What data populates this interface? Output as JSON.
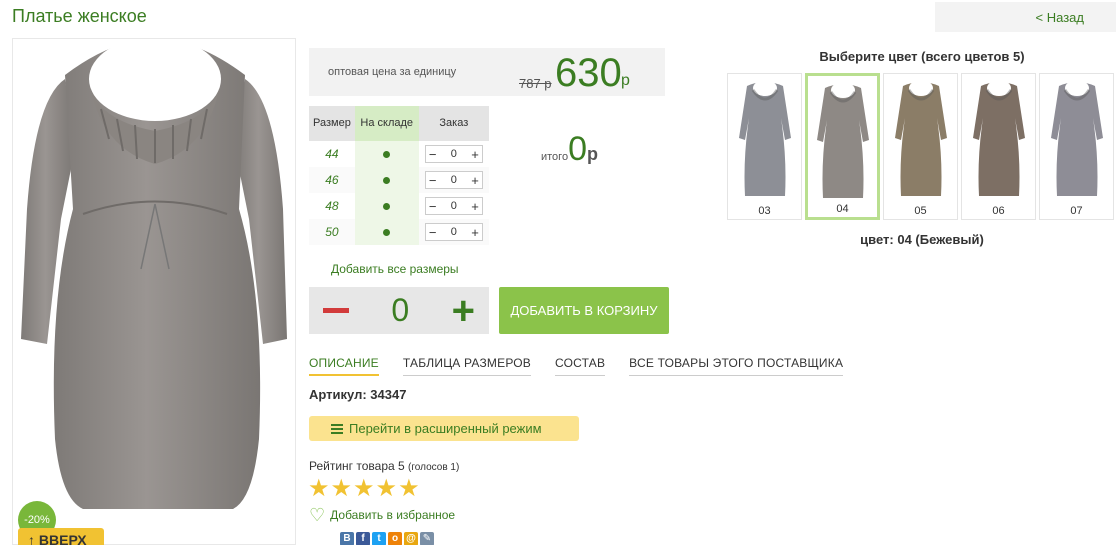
{
  "page_title": "Платье женское",
  "back_label": "< Назад",
  "discount": "-20%",
  "up_label": "↑ ВВЕРХ",
  "price": {
    "label": "оптовая цена за единицу",
    "old": "787 р",
    "new": "630",
    "currency": "р"
  },
  "size_table": {
    "headers": [
      "Размер",
      "На складе",
      "Заказ"
    ],
    "rows": [
      {
        "size": "44",
        "qty": "0"
      },
      {
        "size": "46",
        "qty": "0"
      },
      {
        "size": "48",
        "qty": "0"
      },
      {
        "size": "50",
        "qty": "0"
      }
    ]
  },
  "total": {
    "label": "итого",
    "value": "0",
    "currency": "р"
  },
  "add_all_sizes": "Добавить все размеры",
  "quantity": "0",
  "cart_button": "ДОБАВИТЬ В КОРЗИНУ",
  "tabs": [
    "ОПИСАНИЕ",
    "ТАБЛИЦА РАЗМЕРОВ",
    "СОСТАВ",
    "ВСЕ ТОВАРЫ ЭТОГО ПОСТАВЩИКА"
  ],
  "article": "Артикул: 34347",
  "ext_mode": "Перейти в расширенный режим",
  "rating": {
    "text": "Рейтинг товара 5",
    "votes": "(голосов 1)",
    "stars": 5
  },
  "favorites": "Добавить в избранное",
  "color_picker": {
    "title": "Выберите цвет (всего цветов 5)",
    "swatches": [
      {
        "code": "03",
        "color": "#8d8f96"
      },
      {
        "code": "04",
        "color": "#8e8985"
      },
      {
        "code": "05",
        "color": "#8b7d67"
      },
      {
        "code": "06",
        "color": "#7d6f64"
      },
      {
        "code": "07",
        "color": "#8e8d96"
      }
    ],
    "selected": "цвет: 04 (Бежевый)"
  },
  "social": [
    "В",
    "f",
    "t",
    "о",
    "@",
    "✎"
  ]
}
